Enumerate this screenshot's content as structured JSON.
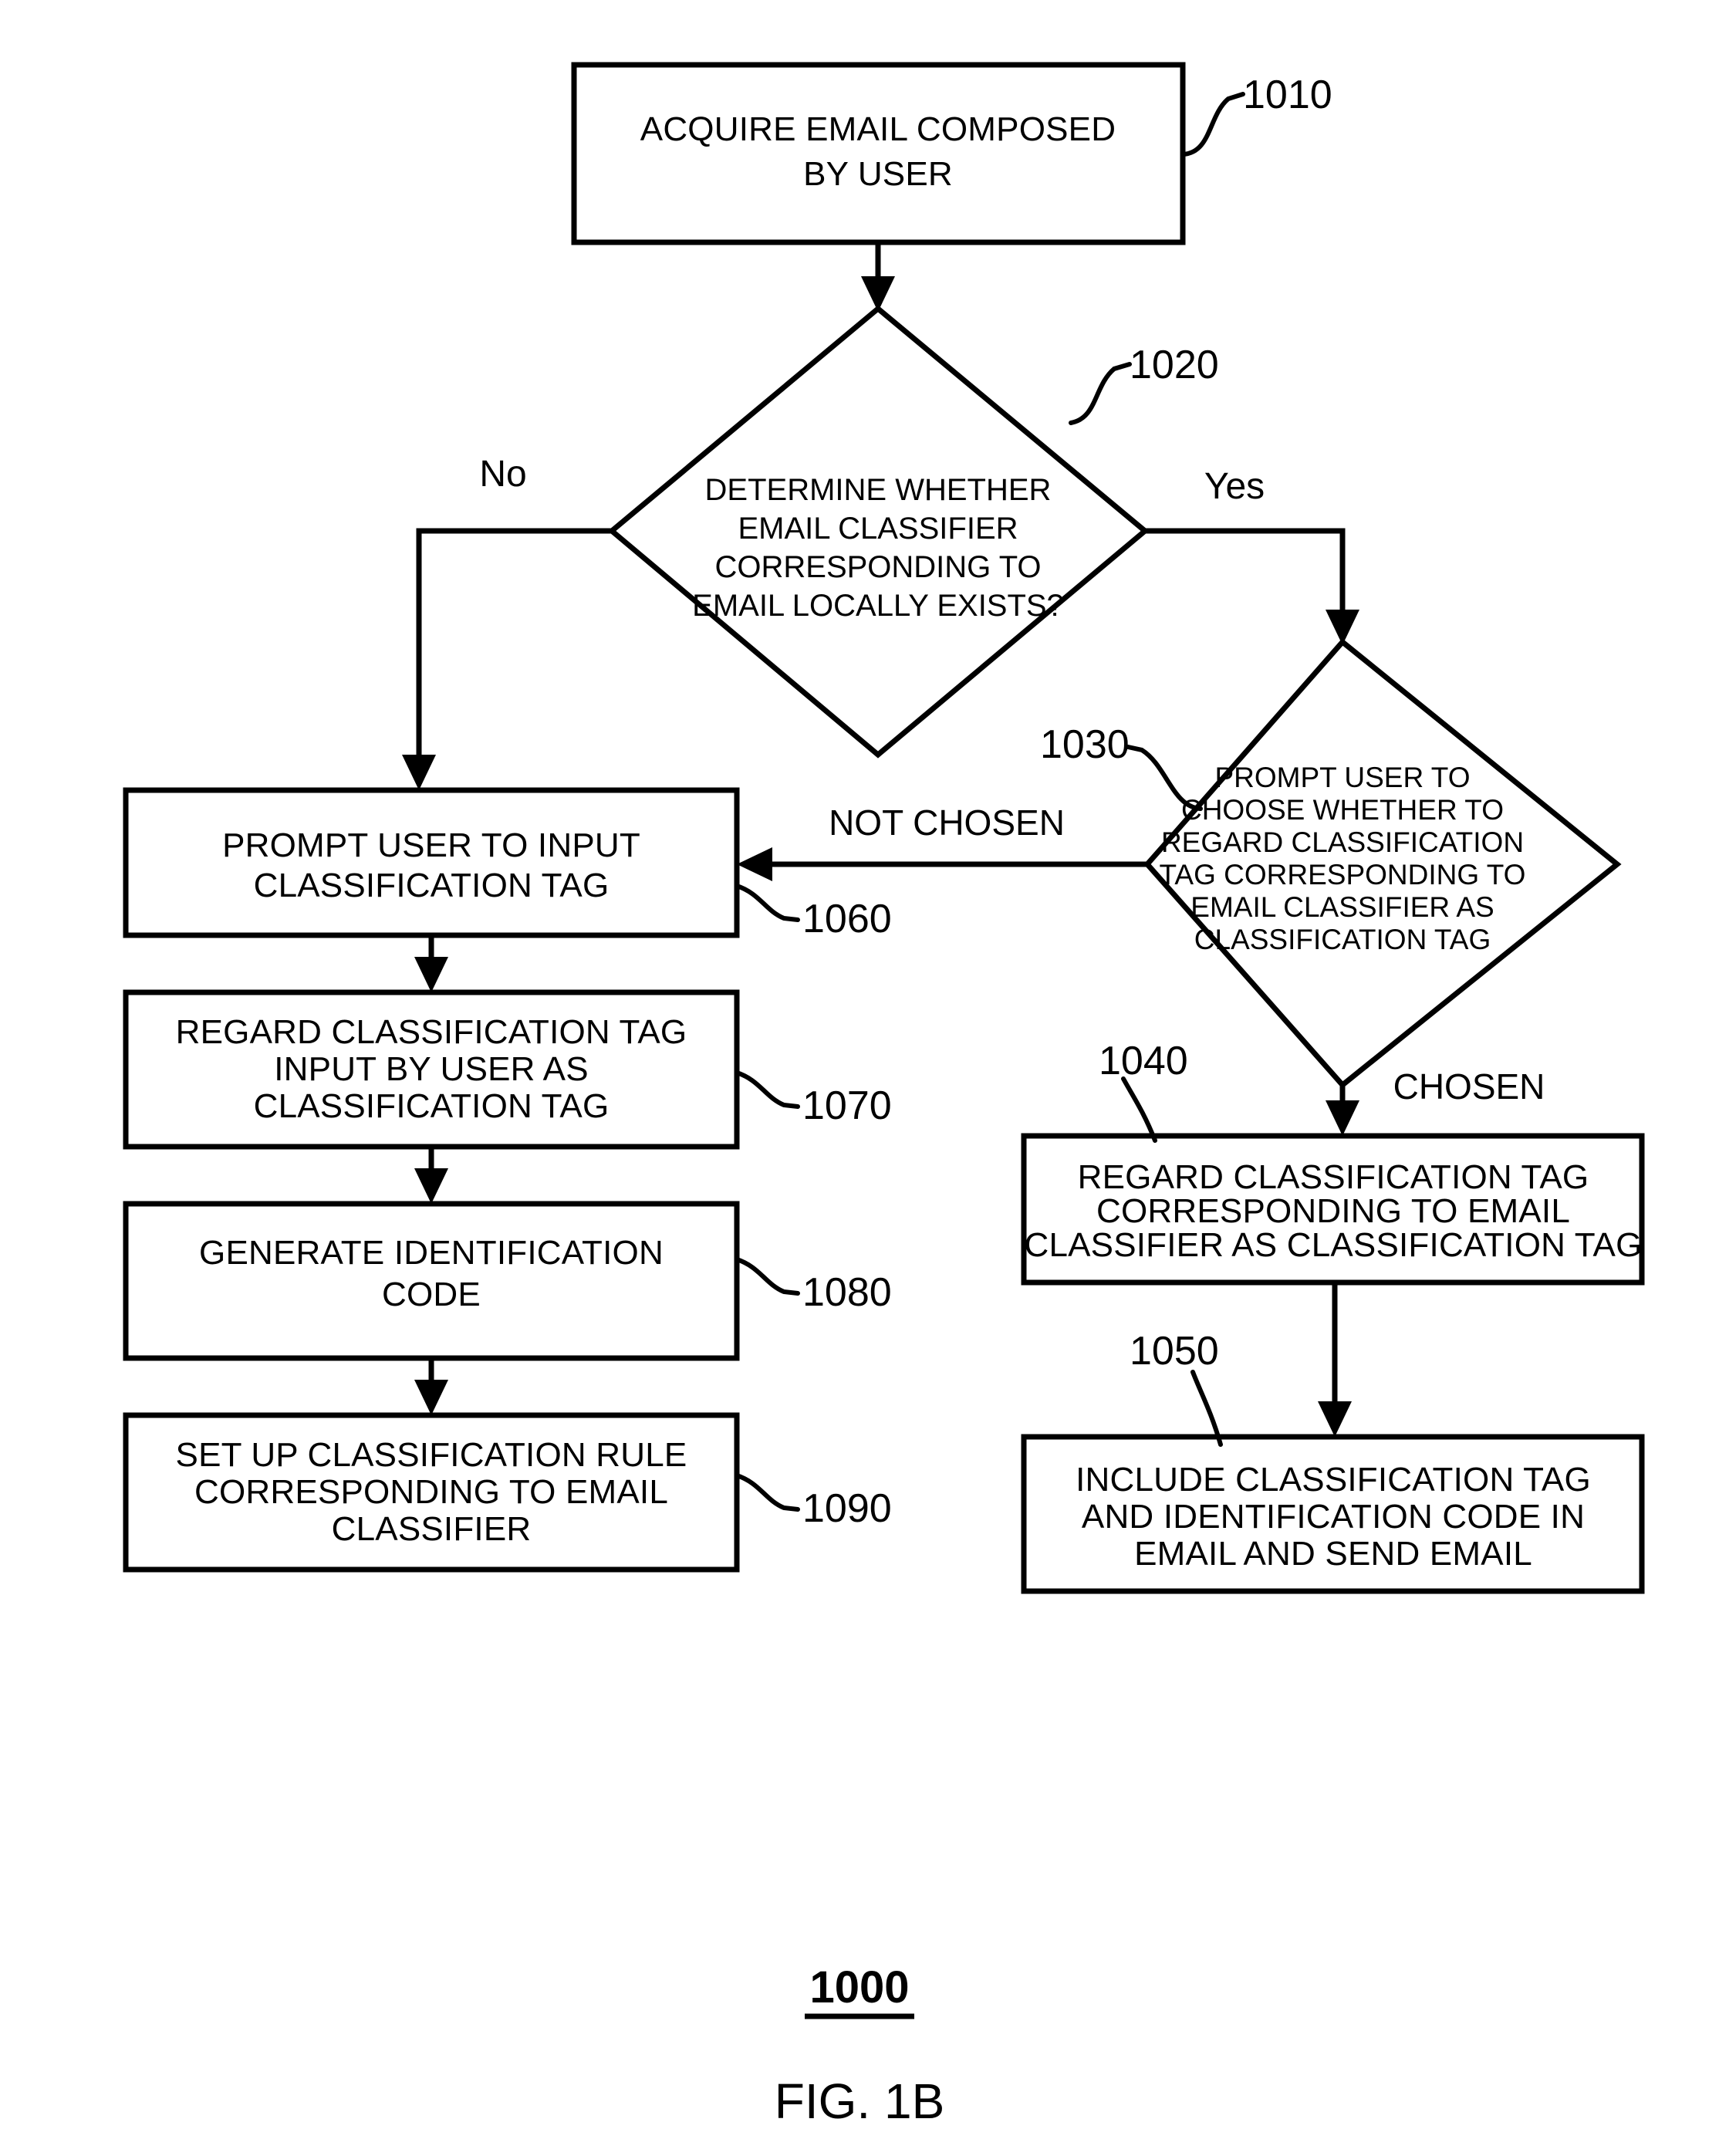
{
  "figure": {
    "number_label": "1000",
    "caption": "FIG. 1B"
  },
  "nodes": {
    "n1010": {
      "ref": "1010",
      "shape": "process",
      "lines": [
        "ACQUIRE EMAIL COMPOSED",
        "BY USER"
      ]
    },
    "n1020": {
      "ref": "1020",
      "shape": "decision",
      "lines": [
        "DETERMINE WHETHER",
        "EMAIL CLASSIFIER",
        "CORRESPONDING TO",
        "EMAIL LOCALLY EXISTS?"
      ]
    },
    "n1030": {
      "ref": "1030",
      "shape": "decision",
      "lines": [
        "PROMPT USER TO",
        "CHOOSE WHETHER TO",
        "REGARD CLASSIFICATION",
        "TAG CORRESPONDING TO",
        "EMAIL CLASSIFIER AS",
        "CLASSIFICATION TAG"
      ]
    },
    "n1040": {
      "ref": "1040",
      "shape": "process",
      "lines": [
        "REGARD CLASSIFICATION TAG",
        "CORRESPONDING TO EMAIL",
        "CLASSIFIER AS CLASSIFICATION TAG"
      ]
    },
    "n1050": {
      "ref": "1050",
      "shape": "process",
      "lines": [
        "INCLUDE CLASSIFICATION TAG",
        "AND IDENTIFICATION CODE IN",
        "EMAIL AND SEND EMAIL"
      ]
    },
    "n1060": {
      "ref": "1060",
      "shape": "process",
      "lines": [
        "PROMPT USER TO INPUT",
        "CLASSIFICATION TAG"
      ]
    },
    "n1070": {
      "ref": "1070",
      "shape": "process",
      "lines": [
        "REGARD CLASSIFICATION TAG",
        "INPUT BY USER AS",
        "CLASSIFICATION TAG"
      ]
    },
    "n1080": {
      "ref": "1080",
      "shape": "process",
      "lines": [
        "GENERATE IDENTIFICATION",
        "CODE"
      ]
    },
    "n1090": {
      "ref": "1090",
      "shape": "process",
      "lines": [
        "SET UP CLASSIFICATION RULE",
        "CORRESPONDING TO EMAIL",
        "CLASSIFIER"
      ]
    }
  },
  "edge_labels": {
    "no": "No",
    "yes": "Yes",
    "not_chosen": "NOT CHOSEN",
    "chosen": "CHOSEN"
  },
  "colors": {
    "ink": "#000000",
    "paper": "#ffffff"
  },
  "chart_data": {
    "type": "diagram",
    "title": "FIG. 1B",
    "diagram_kind": "flowchart",
    "nodes": [
      {
        "id": "1010",
        "type": "process",
        "text": "ACQUIRE EMAIL COMPOSED BY USER"
      },
      {
        "id": "1020",
        "type": "decision",
        "text": "DETERMINE WHETHER EMAIL CLASSIFIER CORRESPONDING TO EMAIL LOCALLY EXISTS?"
      },
      {
        "id": "1030",
        "type": "decision",
        "text": "PROMPT USER TO CHOOSE WHETHER TO REGARD CLASSIFICATION TAG CORRESPONDING TO EMAIL CLASSIFIER AS CLASSIFICATION TAG"
      },
      {
        "id": "1040",
        "type": "process",
        "text": "REGARD CLASSIFICATION TAG CORRESPONDING TO EMAIL CLASSIFIER AS CLASSIFICATION TAG"
      },
      {
        "id": "1050",
        "type": "process",
        "text": "INCLUDE CLASSIFICATION TAG AND IDENTIFICATION CODE IN EMAIL AND SEND EMAIL"
      },
      {
        "id": "1060",
        "type": "process",
        "text": "PROMPT USER TO INPUT CLASSIFICATION TAG"
      },
      {
        "id": "1070",
        "type": "process",
        "text": "REGARD CLASSIFICATION TAG INPUT BY USER AS CLASSIFICATION TAG"
      },
      {
        "id": "1080",
        "type": "process",
        "text": "GENERATE IDENTIFICATION CODE"
      },
      {
        "id": "1090",
        "type": "process",
        "text": "SET UP CLASSIFICATION RULE CORRESPONDING TO EMAIL CLASSIFIER"
      }
    ],
    "edges": [
      {
        "from": "1010",
        "to": "1020",
        "label": ""
      },
      {
        "from": "1020",
        "to": "1060",
        "label": "No"
      },
      {
        "from": "1020",
        "to": "1030",
        "label": "Yes"
      },
      {
        "from": "1030",
        "to": "1060",
        "label": "NOT CHOSEN"
      },
      {
        "from": "1030",
        "to": "1040",
        "label": "CHOSEN"
      },
      {
        "from": "1040",
        "to": "1050",
        "label": ""
      },
      {
        "from": "1060",
        "to": "1070",
        "label": ""
      },
      {
        "from": "1070",
        "to": "1080",
        "label": ""
      },
      {
        "from": "1080",
        "to": "1090",
        "label": ""
      }
    ]
  }
}
